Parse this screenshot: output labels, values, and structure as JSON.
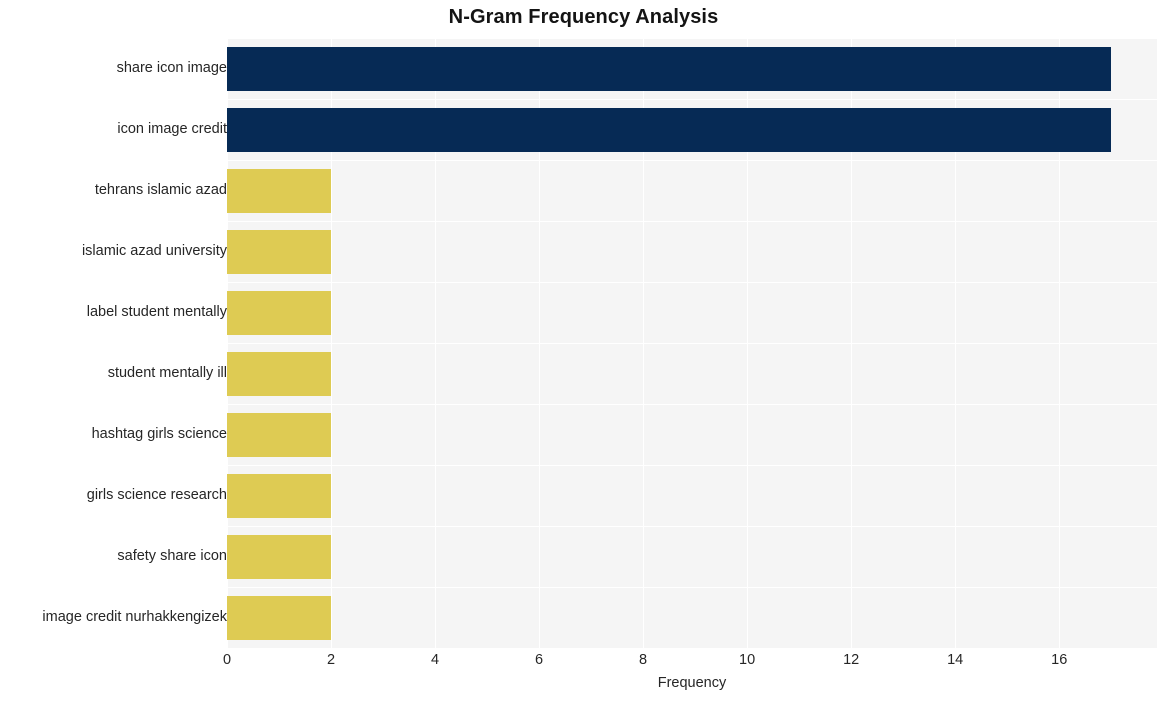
{
  "chart_data": {
    "type": "bar",
    "orientation": "horizontal",
    "title": "N-Gram Frequency Analysis",
    "xlabel": "Frequency",
    "ylabel": "",
    "categories": [
      "share icon image",
      "icon image credit",
      "tehrans islamic azad",
      "islamic azad university",
      "label student mentally",
      "student mentally ill",
      "hashtag girls science",
      "girls science research",
      "safety share icon",
      "image credit nurhakkengizek"
    ],
    "values": [
      17,
      17,
      2,
      2,
      2,
      2,
      2,
      2,
      2,
      2
    ],
    "bar_colors": [
      "#062a55",
      "#062a55",
      "#decb53",
      "#decb53",
      "#decb53",
      "#decb53",
      "#decb53",
      "#decb53",
      "#decb53",
      "#decb53"
    ],
    "xticks": [
      0,
      2,
      4,
      6,
      8,
      10,
      12,
      14,
      16
    ],
    "xtick_labels": [
      "0",
      "2",
      "4",
      "6",
      "8",
      "10",
      "12",
      "14",
      "16"
    ],
    "xlim": [
      0,
      17.88
    ],
    "grid": true,
    "grid_color": "#ffffff",
    "legend": null,
    "plot_background": "#f5f5f5",
    "figure_background": "#ffffff",
    "title_color": "#141414",
    "tick_label_color": "#262626"
  }
}
